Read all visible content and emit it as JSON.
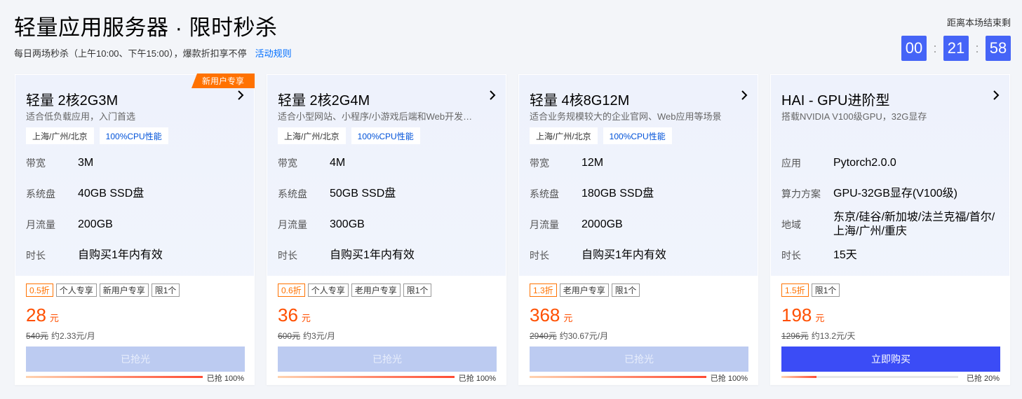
{
  "header": {
    "title": "轻量应用服务器 · 限时秒杀",
    "subtitle": "每日两场秒杀（上午10:00、下午15:00），爆款折扣享不停",
    "rules_link": "活动规则"
  },
  "countdown": {
    "label": "距离本场结束剩",
    "hours": "00",
    "minutes": "21",
    "seconds": "58",
    "separator": ":"
  },
  "colors": {
    "accent": "#4564f7",
    "price": "#ff4f00",
    "ribbon": "#ff7200",
    "link": "#006eff"
  },
  "cards": [
    {
      "ribbon": "新用户专享",
      "name": "轻量 2核2G3M",
      "desc": "适合低负载应用，入门首选",
      "tags": [
        "上海/广州/北京",
        "100%CPU性能"
      ],
      "specs": [
        {
          "label": "带宽",
          "value": "3M"
        },
        {
          "label": "系统盘",
          "value": "40GB SSD盘"
        },
        {
          "label": "月流量",
          "value": "200GB"
        },
        {
          "label": "时长",
          "value": "自购买1年内有效"
        }
      ],
      "discount_tags": [
        "0.5折",
        "个人专享",
        "新用户专享",
        "限1个"
      ],
      "price": "28",
      "price_unit": "元",
      "original_price": "540元",
      "per_unit": "约2.33元/月",
      "button": "已抢光",
      "button_state": "disabled",
      "progress_pct": 100,
      "progress_text": "已抢 100%"
    },
    {
      "ribbon": "",
      "name": "轻量 2核2G4M",
      "desc": "适合小型网站、小程序/小游戏后端和Web开发…",
      "tags": [
        "上海/广州/北京",
        "100%CPU性能"
      ],
      "specs": [
        {
          "label": "带宽",
          "value": "4M"
        },
        {
          "label": "系统盘",
          "value": "50GB SSD盘"
        },
        {
          "label": "月流量",
          "value": "300GB"
        },
        {
          "label": "时长",
          "value": "自购买1年内有效"
        }
      ],
      "discount_tags": [
        "0.6折",
        "个人专享",
        "老用户专享",
        "限1个"
      ],
      "price": "36",
      "price_unit": "元",
      "original_price": "600元",
      "per_unit": "约3元/月",
      "button": "已抢光",
      "button_state": "disabled",
      "progress_pct": 100,
      "progress_text": "已抢 100%"
    },
    {
      "ribbon": "",
      "name": "轻量 4核8G12M",
      "desc": "适合业务规模较大的企业官网、Web应用等场景",
      "tags": [
        "上海/广州/北京",
        "100%CPU性能"
      ],
      "specs": [
        {
          "label": "带宽",
          "value": "12M"
        },
        {
          "label": "系统盘",
          "value": "180GB SSD盘"
        },
        {
          "label": "月流量",
          "value": "2000GB"
        },
        {
          "label": "时长",
          "value": "自购买1年内有效"
        }
      ],
      "discount_tags": [
        "1.3折",
        "老用户专享",
        "限1个"
      ],
      "price": "368",
      "price_unit": "元",
      "original_price": "2940元",
      "per_unit": "约30.67元/月",
      "button": "已抢光",
      "button_state": "disabled",
      "progress_pct": 100,
      "progress_text": "已抢 100%"
    },
    {
      "ribbon": "",
      "name": "HAI - GPU进阶型",
      "desc": "搭载NVIDIA V100级GPU，32G显存",
      "tags": [],
      "specs": [
        {
          "label": "应用",
          "value": "Pytorch2.0.0"
        },
        {
          "label": "算力方案",
          "value": "GPU-32GB显存(V100级)"
        },
        {
          "label": "地域",
          "value": "东京/硅谷/新加坡/法兰克福/首尔/上海/广州/重庆"
        },
        {
          "label": "时长",
          "value": "15天"
        }
      ],
      "discount_tags": [
        "1.5折",
        "限1个"
      ],
      "price": "198",
      "price_unit": "元",
      "original_price": "1296元",
      "per_unit": "约13.2元/天",
      "button": "立即购买",
      "button_state": "active",
      "progress_pct": 20,
      "progress_text": "已抢 20%"
    }
  ]
}
